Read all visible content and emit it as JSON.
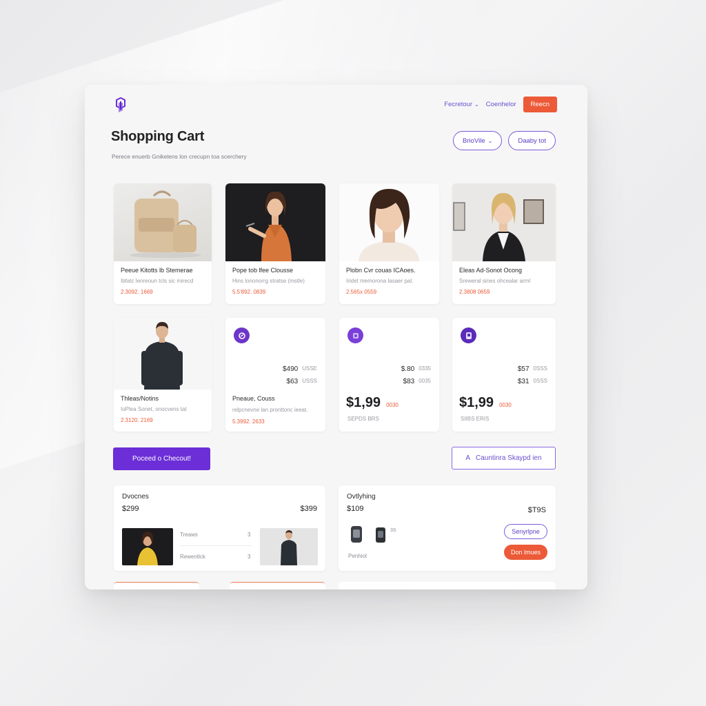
{
  "nav": {
    "link1": "Fecretour",
    "link2": "Coenhelor",
    "cta": "Reecn"
  },
  "header": {
    "title": "Shopping Cart",
    "subtitle": "Perece enuerb Gnikelens lon crecupn toa scerchery",
    "btn1": "BrioVile",
    "btn2": "Daaby tot"
  },
  "colors": {
    "accent": "#6c2ed6",
    "orange": "#ec5a37",
    "purple_text": "#6a4fcf"
  },
  "products": [
    {
      "name": "Peeue Kitotts lb Stemerae",
      "desc": "Ibfatc lenreoun tcls sic mirecd",
      "price": "2.3092. 1669",
      "icon": "backpack-photo"
    },
    {
      "name": "Pope tob lfee Clousse",
      "desc": "Hins lononorrg stratse (mstle)",
      "price": "5.5'892. 0839",
      "icon": "woman-orange-shirt-photo"
    },
    {
      "name": "Plobn Cvr couas ICAoes.",
      "desc": "Iridet memorona lasaer pal.",
      "price": "2.565x 0559",
      "icon": "woman-portrait-photo"
    },
    {
      "name": "Eleas Ad-Sonot Ocong",
      "desc": "Sreweral sines ohcealar arml",
      "price": "2.3808 0659",
      "icon": "woman-blazer-photo"
    },
    {
      "name": "Thleas/Notins",
      "desc": "IoPlea Sonet, onocvens tat",
      "price": "2.3120. 2169",
      "icon": "man-dark-shirt-photo"
    }
  ],
  "price_cards": [
    {
      "name": "Pneaue, Couss",
      "desc": "relpcnevne lan pronttonc ieeat.",
      "price": "5.3992. 2633",
      "row1": "$490",
      "row1_alt": "USSE",
      "row2": "$63",
      "row2_alt": "USSS"
    },
    {
      "big": "$1,99",
      "big_alt": "0030",
      "small": "SEPDS BRS",
      "row1": "$.80",
      "row1_alt": "0335",
      "row2": "$83",
      "row2_alt": "0035"
    },
    {
      "big": "$1,99",
      "big_alt": "0030",
      "small": "SIIBS ERIS",
      "row1": "$57",
      "row1_alt": "0SSS",
      "row2": "$31",
      "row2_alt": "0SSS"
    }
  ],
  "actions": {
    "primary": "Poceed o Checout!",
    "secondary": "Cauntinra Skaypd ien",
    "secondary_arrow": "A"
  },
  "summary_left": {
    "title": "Dvocnes",
    "value_left": "$299",
    "value_right": "$399",
    "row1_label": "Treaws",
    "row1_val": "3",
    "row2_label": "Rewentlck",
    "row2_val": "3"
  },
  "summary_right": {
    "title": "Ovtlyhing",
    "value_left": "$109",
    "value_right": "$T9S",
    "device_label": "3S",
    "footer": "Penhiot",
    "btn_outline": "Senyrlpne",
    "btn_fill": "Don lmues"
  }
}
